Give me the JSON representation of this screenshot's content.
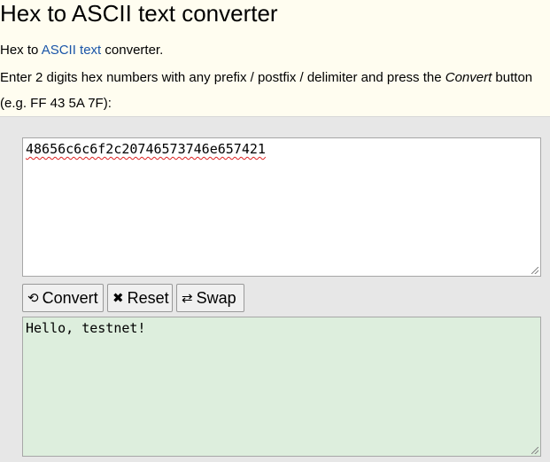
{
  "page": {
    "title": "Hex to ASCII text converter",
    "intro_prefix": "Hex to ",
    "intro_link": "ASCII text",
    "intro_suffix": " converter.",
    "instruction_prefix": "Enter 2 digits hex numbers with any prefix / postfix / delimiter and press the ",
    "instruction_em": "Convert",
    "instruction_suffix": " button",
    "example": "(e.g. FF 43 5A 7F):"
  },
  "input": {
    "value": "48656c6c6f2c20746573746e657421"
  },
  "output": {
    "value": "Hello, testnet!"
  },
  "buttons": {
    "convert": {
      "icon": "refresh-icon",
      "glyph": "⟲",
      "label": "Convert"
    },
    "reset": {
      "icon": "close-icon",
      "glyph": "✖",
      "label": "Reset"
    },
    "swap": {
      "icon": "swap-icon",
      "glyph": "⇄",
      "label": "Swap"
    }
  }
}
